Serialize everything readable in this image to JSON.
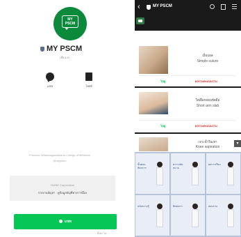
{
  "profile": {
    "logo_text": "MY PSCM",
    "account_name": "MY PSCM",
    "account_id": "เพื่อน 51",
    "actions": [
      {
        "label": "แชท",
        "icon": "chat-bubble-icon"
      },
      {
        "label": "โพสต์",
        "icon": "document-icon"
      }
    ],
    "description": "Princess Srisavangavadhana College of Medicine",
    "handle": "@mypscm",
    "provider_title": "DLINE Corporation",
    "provider_body": "รายงานปัญหา · ดูข้อมูลบัญชีทางการนี้ลง",
    "chat_button_label": "แชท",
    "footer_note": "ตั้งค่า ไอ"
  },
  "chat": {
    "title": "MY PSCM",
    "lessons": [
      {
        "thai": "เย็บแผล",
        "english": "Simple suture",
        "action_green": "ไปดู",
        "action_red": "ผลรวมคะแนนรวม"
      },
      {
        "thai": "ใส่เฝือกอ่อนข้อมือ",
        "english": "Short arm slab",
        "action_green": "ไปดู",
        "action_red": "ผลรวมคะแนนรวม"
      },
      {
        "thai": "เจาะน้ำในเข่า",
        "english": "Knee aspiration"
      }
    ],
    "rich_menu": [
      {
        "label": "ขั้นตอน หัตถการ"
      },
      {
        "label": "ตารางนัดหมาย"
      },
      {
        "label": "ผลการเรียน"
      },
      {
        "label": "คลังความรู้"
      },
      {
        "label": "ติดต่อเรา"
      },
      {
        "label": "สอบถาม"
      }
    ]
  }
}
